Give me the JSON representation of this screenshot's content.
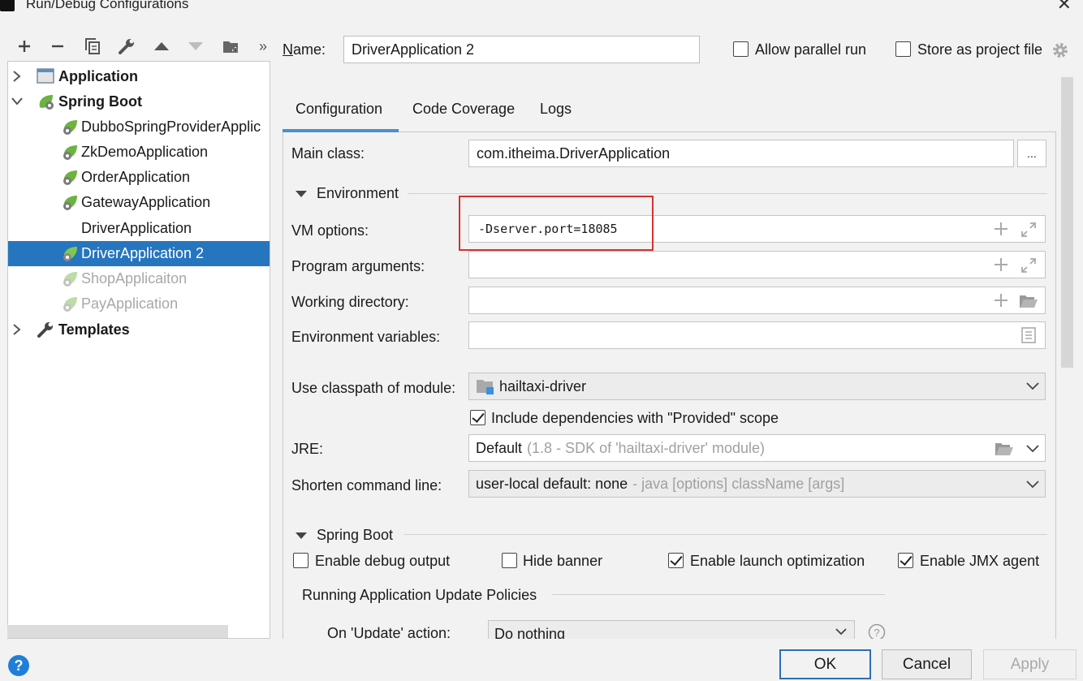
{
  "window": {
    "title": "Run/Debug Configurations"
  },
  "toolbar": {
    "add": "+",
    "remove": "−",
    "more": "»"
  },
  "tree": {
    "items": [
      {
        "label": "Application",
        "kind": "group"
      },
      {
        "label": "Spring Boot",
        "kind": "group"
      },
      {
        "label": "DubboSpringProviderApplic",
        "kind": "child"
      },
      {
        "label": "ZkDemoApplication",
        "kind": "child"
      },
      {
        "label": "OrderApplication",
        "kind": "child"
      },
      {
        "label": "GatewayApplication",
        "kind": "child"
      },
      {
        "label": "DriverApplication",
        "kind": "child"
      },
      {
        "label": "DriverApplication 2",
        "kind": "child",
        "selected": true
      },
      {
        "label": "ShopApplicaiton",
        "kind": "child",
        "disabled": true
      },
      {
        "label": "PayApplication",
        "kind": "child",
        "disabled": true
      },
      {
        "label": "Templates",
        "kind": "group"
      }
    ]
  },
  "header": {
    "name_label": "Name:",
    "name_value": "DriverApplication 2",
    "allow_parallel": "Allow parallel run",
    "store_project": "Store as project file"
  },
  "tabs": [
    "Configuration",
    "Code Coverage",
    "Logs"
  ],
  "form": {
    "main_class_label": "Main class:",
    "main_class_value": "com.itheima.DriverApplication",
    "browse": "...",
    "environment": "Environment",
    "vm_label": "VM options:",
    "vm_value": "-Dserver.port=18085",
    "program_args_label": "Program arguments:",
    "workdir_label": "Working directory:",
    "envvars_label": "Environment variables:",
    "classpath_label": "Use classpath of module:",
    "classpath_value": "hailtaxi-driver",
    "include_deps": "Include dependencies with \"Provided\" scope",
    "jre_label": "JRE:",
    "jre_value": "Default",
    "jre_hint": "(1.8 - SDK of 'hailtaxi-driver' module)",
    "shorten_label": "Shorten command line:",
    "shorten_value": "user-local default: none",
    "shorten_hint": "- java [options] className [args]",
    "spring_boot": "Spring Boot",
    "debug_output": "Enable debug output",
    "hide_banner": "Hide banner",
    "launch_opt": "Enable launch optimization",
    "jmx_agent": "Enable JMX agent",
    "update_policies": "Running Application Update Policies",
    "on_update_label": "On 'Update' action:",
    "on_update_value": "Do nothing"
  },
  "footer": {
    "ok": "OK",
    "cancel": "Cancel",
    "apply": "Apply",
    "help": "?"
  },
  "colors": {
    "selection": "#2675bf",
    "highlight_box": "#d93030",
    "spring_green": "#6db33f"
  }
}
